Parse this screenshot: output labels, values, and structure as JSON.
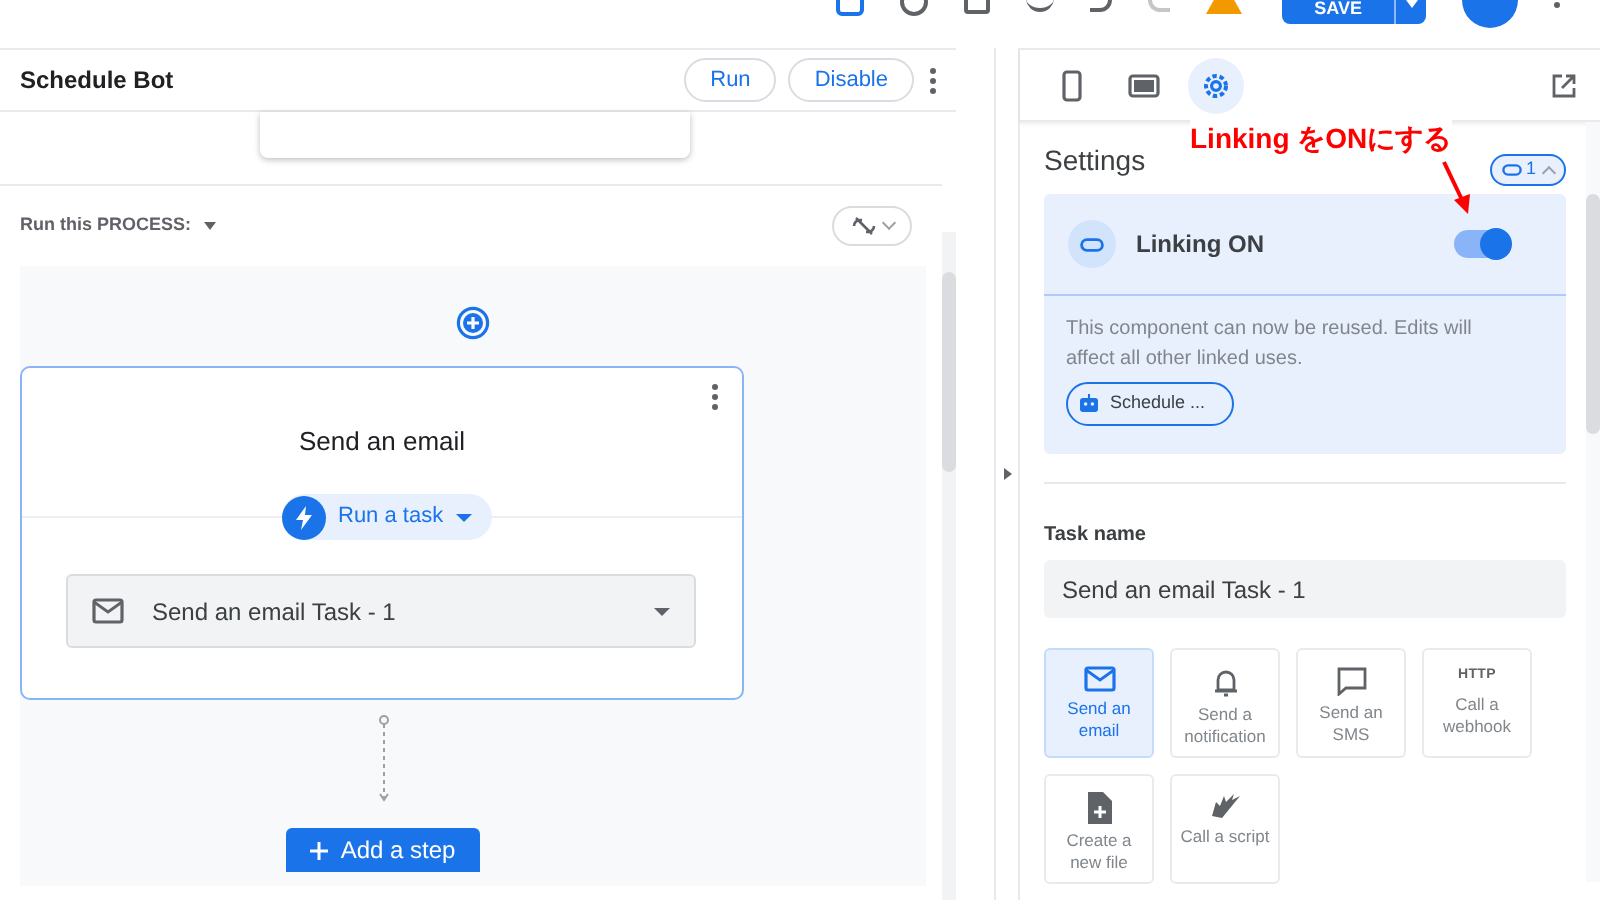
{
  "toolbar": {
    "save_button": "SAVE"
  },
  "editor": {
    "title": "Schedule Bot",
    "buttons": [
      "Run",
      "Disable"
    ],
    "process_label": "Run this PROCESS:",
    "step": {
      "title": "Send an email",
      "action": "Run a task",
      "task": "Send an email Task - 1"
    },
    "add_step": "Add a step"
  },
  "panel": {
    "tabs": [
      {
        "kind": "phone",
        "selected": false
      },
      {
        "kind": "tablet",
        "selected": false
      },
      {
        "kind": "settings",
        "selected": true
      }
    ],
    "annotation": "Linking をONにする",
    "heading": "Settings",
    "link_count": "1",
    "linking": {
      "label": "Linking ON",
      "on": true,
      "description": "This component can now be reused. Edits will affect all other linked uses.",
      "chip": "Schedule ..."
    },
    "task_name_label": "Task name",
    "task_name": "Send an email Task - 1",
    "task_types": [
      {
        "kind": "email",
        "label": "Send an email",
        "selected": true
      },
      {
        "kind": "bell",
        "label": "Send a notification",
        "selected": false
      },
      {
        "kind": "sms",
        "label": "Send an SMS",
        "selected": false
      },
      {
        "kind": "http",
        "icon_text": "HTTP",
        "label": "Call a webhook",
        "selected": false
      },
      {
        "kind": "file",
        "label": "Create a new file",
        "selected": false
      },
      {
        "kind": "script",
        "label": "Call a script",
        "selected": false
      }
    ]
  }
}
